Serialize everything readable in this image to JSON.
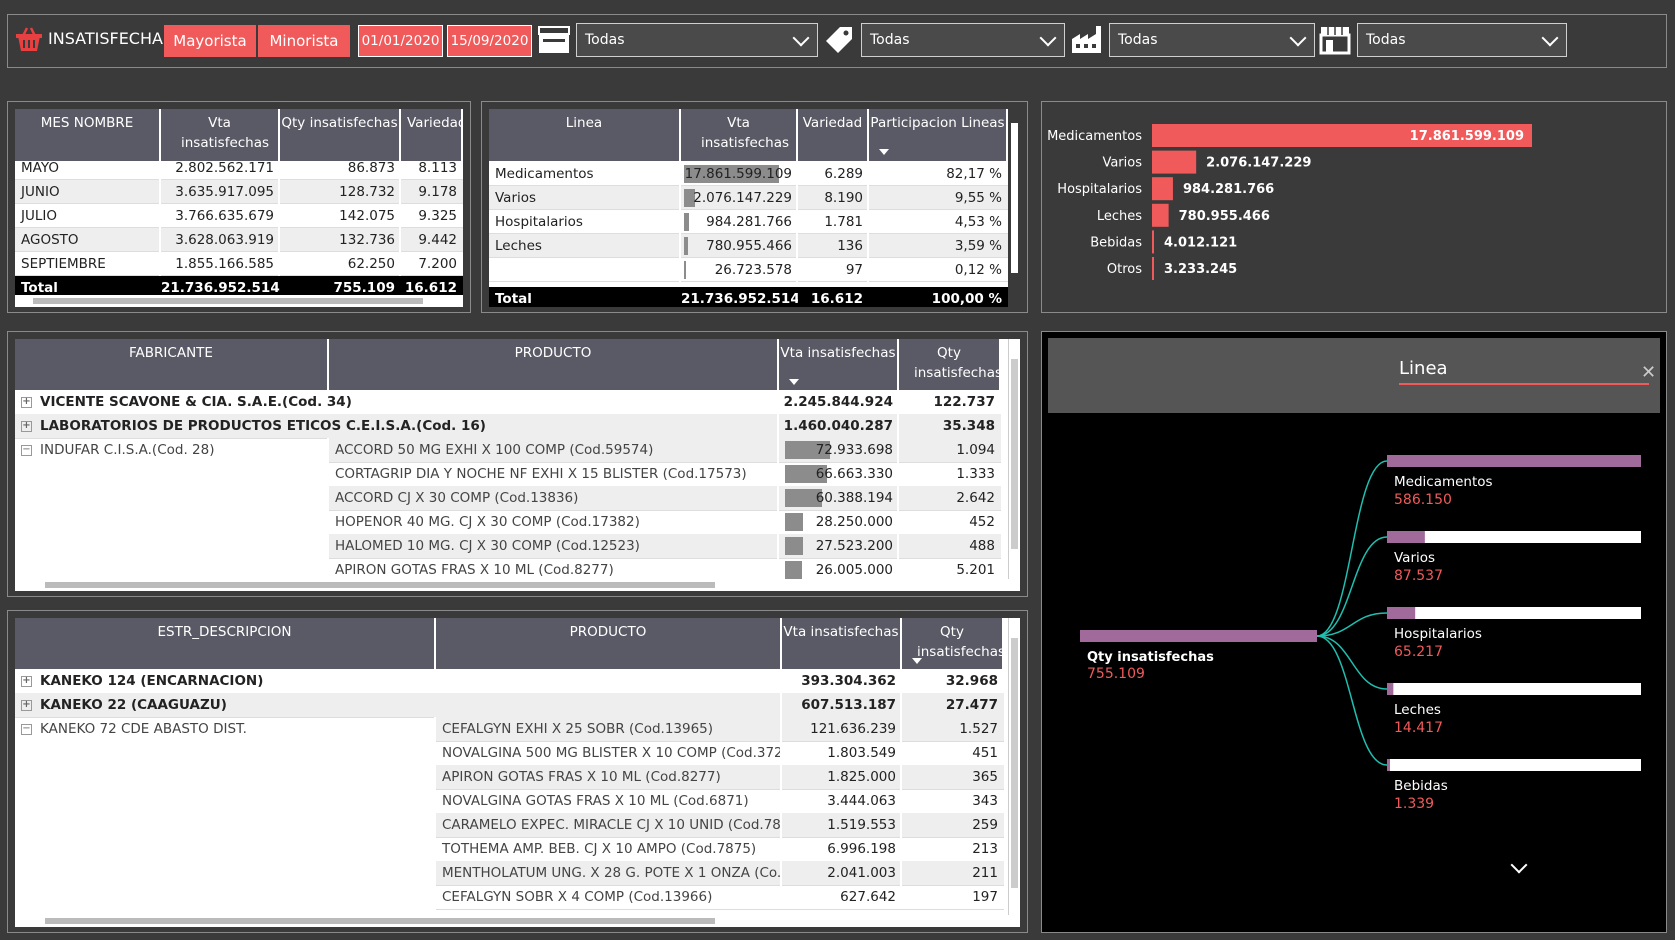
{
  "header": {
    "title": "INSATISFECHAS",
    "btn_mayorista": "Mayorista",
    "btn_minorista": "Minorista",
    "date_from": "01/01/2020",
    "date_to": "15/09/2020",
    "filter1": "Todas",
    "filter2": "Todas",
    "filter3": "Todas",
    "filter4": "Todas",
    "accent": "#f05a5a"
  },
  "mes_table": {
    "headers": [
      "MES NOMBRE",
      "Vta insatisfechas",
      "Qty insatisfechas",
      "Variedad"
    ],
    "rows": [
      [
        "MAYO",
        "2.802.562.171",
        "86.873",
        "8.113"
      ],
      [
        "JUNIO",
        "3.635.917.095",
        "128.732",
        "9.178"
      ],
      [
        "JULIO",
        "3.766.635.679",
        "142.075",
        "9.325"
      ],
      [
        "AGOSTO",
        "3.628.063.919",
        "132.736",
        "9.442"
      ],
      [
        "SEPTIEMBRE",
        "1.855.166.585",
        "62.250",
        "7.200"
      ]
    ],
    "total": [
      "Total",
      "21.736.952.514",
      "755.109",
      "16.612"
    ]
  },
  "linea_table": {
    "headers": [
      "Linea",
      "Vta insatisfechas",
      "Variedad",
      "Participacion Lineas"
    ],
    "rows": [
      [
        "Medicamentos",
        "17.861.599.109",
        "6.289",
        "82,17 %"
      ],
      [
        "Varios",
        "2.076.147.229",
        "8.190",
        "9,55 %"
      ],
      [
        "Hospitalarios",
        "984.281.766",
        "1.781",
        "4,53 %"
      ],
      [
        "Leches",
        "780.955.466",
        "136",
        "3,59 %"
      ],
      [
        "",
        "26.723.578",
        "97",
        "0,12 %"
      ]
    ],
    "bar_fraction": [
      1.0,
      0.116,
      0.055,
      0.044,
      0.0015
    ],
    "total": [
      "Total",
      "21.736.952.514",
      "16.612",
      "100,00 %"
    ]
  },
  "chart_data": {
    "type": "bar",
    "categories": [
      "Medicamentos",
      "Varios",
      "Hospitalarios",
      "Leches",
      "Bebidas",
      "Otros"
    ],
    "values": [
      17861599109,
      2076147229,
      984281766,
      780955466,
      4012121,
      3233245
    ],
    "labels": [
      "17.861.599.109",
      "2.076.147.229",
      "984.281.766",
      "780.955.466",
      "4.012.121",
      "3.233.245"
    ],
    "color": "#f05a5a"
  },
  "fab_table": {
    "headers": [
      "FABRICANTE",
      "PRODUCTO",
      "Vta insatisfechas",
      "Qty insatisfechas"
    ],
    "groups": [
      {
        "name": "VICENTE SCAVONE & CIA. S.A.E.(Cod. 34)",
        "vta": "2.245.844.924",
        "qty": "122.737"
      },
      {
        "name": "LABORATORIOS DE PRODUCTOS ETICOS C.E.I.S.A.(Cod. 16)",
        "vta": "1.460.040.287",
        "qty": "35.348"
      }
    ],
    "expanded": "INDUFAR C.I.S.A.(Cod. 28)",
    "rows": [
      [
        "ACCORD 50 MG EXHI X 100 COMP (Cod.59574)",
        "72.933.698",
        "1.094"
      ],
      [
        "CORTAGRIP DIA Y NOCHE NF EXHI X 15 BLISTER (Cod.17573)",
        "66.663.330",
        "1.333"
      ],
      [
        "ACCORD CJ X 30 COMP (Cod.13836)",
        "60.388.194",
        "2.642"
      ],
      [
        "HOPENOR 40 MG. CJ X 30 COMP (Cod.17382)",
        "28.250.000",
        "452"
      ],
      [
        "HALOMED 10 MG. CJ X 30 COMP (Cod.12523)",
        "27.523.200",
        "488"
      ],
      [
        "APIRON GOTAS FRAS X 10 ML (Cod.8277)",
        "26.005.000",
        "5.201"
      ]
    ],
    "bar_fraction": [
      0.41,
      0.38,
      0.34,
      0.16,
      0.16,
      0.15
    ]
  },
  "estr_table": {
    "headers": [
      "ESTR_DESCRIPCION",
      "PRODUCTO",
      "Vta insatisfechas",
      "Qty insatisfechas"
    ],
    "groups": [
      {
        "name": "KANEKO 124 (ENCARNACION)",
        "vta": "393.304.362",
        "qty": "32.968"
      },
      {
        "name": "KANEKO 22 (CAAGUAZU)",
        "vta": "607.513.187",
        "qty": "27.477"
      }
    ],
    "expanded": "KANEKO 72 CDE ABASTO DIST.",
    "rows": [
      [
        "CEFALGYN EXHI X 25 SOBR (Cod.13965)",
        "121.636.239",
        "1.527"
      ],
      [
        "NOVALGINA 500 MG BLISTER X 10 COMP (Cod.372...",
        "1.803.549",
        "451"
      ],
      [
        "APIRON GOTAS FRAS X 10 ML (Cod.8277)",
        "1.825.000",
        "365"
      ],
      [
        "NOVALGINA GOTAS FRAS X 10 ML (Cod.6871)",
        "3.444.063",
        "343"
      ],
      [
        "CARAMELO EXPEC. MIRACLE CJ X 10 UNID (Cod.78...",
        "1.519.553",
        "259"
      ],
      [
        "TOTHEMA AMP. BEB. CJ X 10 AMPO (Cod.7875)",
        "6.996.198",
        "213"
      ],
      [
        "MENTHOLATUM UNG. X 28 G. POTE X 1 ONZA (Co...",
        "2.041.003",
        "211"
      ],
      [
        "CEFALGYN SOBR X 4 COMP (Cod.13966)",
        "627.642",
        "197"
      ]
    ]
  },
  "tree": {
    "panel_title": "Linea",
    "root_label": "Qty insatisfechas",
    "root_value": "755.109",
    "nodes": [
      {
        "label": "Medicamentos",
        "value": "586.150",
        "fraction": 1.0
      },
      {
        "label": "Varios",
        "value": "87.537",
        "fraction": 0.149
      },
      {
        "label": "Hospitalarios",
        "value": "65.217",
        "fraction": 0.111
      },
      {
        "label": "Leches",
        "value": "14.417",
        "fraction": 0.025
      },
      {
        "label": "Bebidas",
        "value": "1.339",
        "fraction": 0.002
      }
    ]
  }
}
